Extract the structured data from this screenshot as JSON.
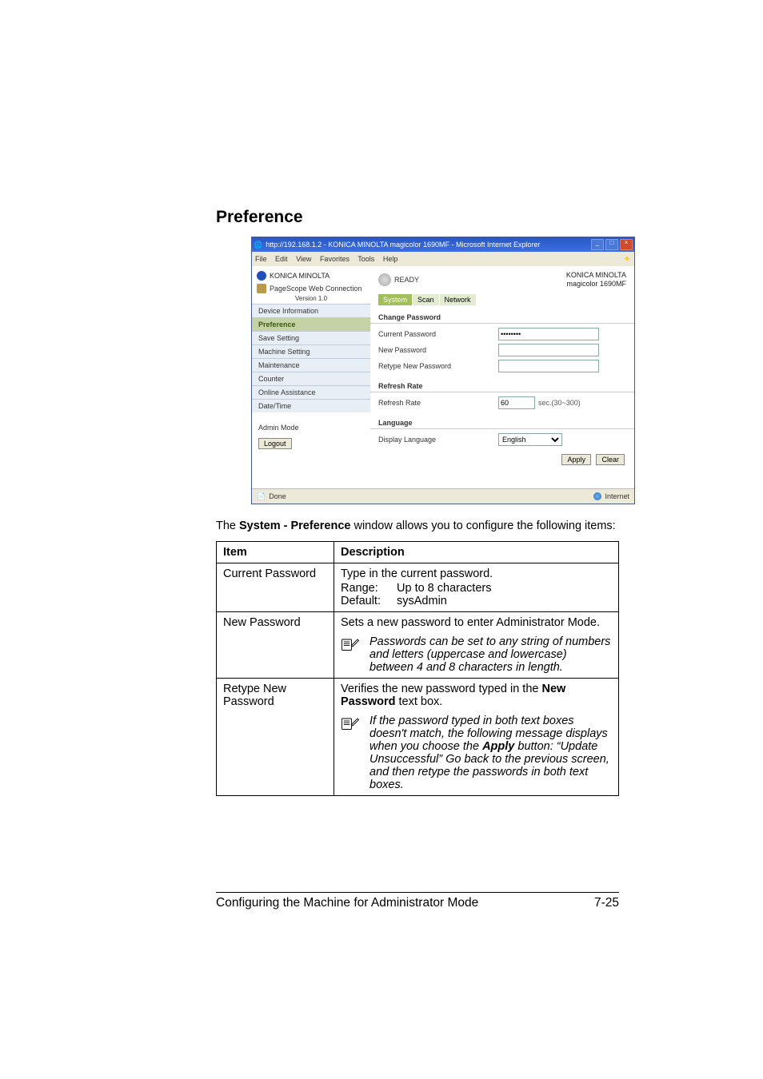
{
  "heading": "Preference",
  "ie": {
    "title": "http://192.168.1.2 - KONICA MINOLTA magicolor 1690MF - Microsoft Internet Explorer",
    "menu": [
      "File",
      "Edit",
      "View",
      "Favorites",
      "Tools",
      "Help"
    ],
    "brand": "KONICA MINOLTA",
    "page_service": "PageScope Web Connection",
    "version": "Version 1.0",
    "nav": {
      "items": [
        "Device Information",
        "Preference",
        "Save Setting",
        "Machine Setting",
        "Maintenance",
        "Counter",
        "Online Assistance",
        "Date/Time"
      ],
      "active_index": 1
    },
    "admin_mode": "Admin Mode",
    "logout": "Logout",
    "status": {
      "ready": "READY",
      "company": "KONICA MINOLTA",
      "model": "magicolor 1690MF"
    },
    "tabs": [
      "System",
      "Scan",
      "Network"
    ],
    "active_tab": 0,
    "sections": {
      "change_password": {
        "title": "Change Password",
        "current": "Current Password",
        "current_value": "••••••••",
        "newp": "New Password",
        "retype": "Retype New Password"
      },
      "refresh": {
        "title": "Refresh Rate",
        "label": "Refresh Rate",
        "value": "60",
        "unit": "sec.(30~300)"
      },
      "language": {
        "title": "Language",
        "label": "Display Language",
        "value": "English"
      }
    },
    "apply": "Apply",
    "clear": "Clear",
    "status_bar_left": "Done",
    "status_bar_right": "Internet"
  },
  "intro": {
    "t1": "The ",
    "t2": "System - Preference",
    "t3": " window allows you to configure the following items:"
  },
  "table": {
    "headers": [
      "Item",
      "Description"
    ],
    "rows": [
      {
        "item": "Current Password",
        "desc": "Type in the current password.",
        "specs": [
          {
            "label": "Range:",
            "value": "Up to 8 characters"
          },
          {
            "label": "Default:",
            "value": "sysAdmin"
          }
        ]
      },
      {
        "item": "New Password",
        "desc": "Sets a new password to enter Administrator Mode.",
        "note": "Passwords can be set to any string of numbers and letters (uppercase and lowercase) between 4 and 8 characters in length."
      },
      {
        "item": "Retype New Password",
        "desc_pre": "Verifies the new password typed in the ",
        "desc_bold": "New Password",
        "desc_post": " text box.",
        "note_pre": "If the password typed in both text boxes doesn't match, the following message displays when you choose the ",
        "note_bold": "Apply",
        "note_post": " button: “Update Unsuccessful” Go back to the previous screen, and then retype the passwords in both text boxes."
      }
    ]
  },
  "footer": {
    "left": "Configuring the Machine for Administrator Mode",
    "right": "7-25"
  }
}
